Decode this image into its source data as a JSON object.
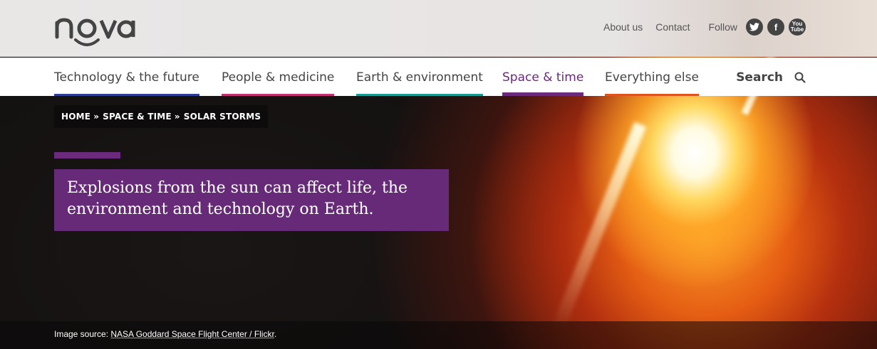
{
  "header": {
    "logo_text": "nova",
    "links": [
      "About us",
      "Contact"
    ],
    "follow_label": "Follow",
    "social": [
      {
        "icon": "twitter-icon",
        "glyph": "t"
      },
      {
        "icon": "facebook-icon",
        "glyph": "f"
      },
      {
        "icon": "youtube-icon",
        "glyph": "You Tube"
      }
    ]
  },
  "nav": {
    "items": [
      {
        "label": "Technology & the future",
        "color": "#2e3f95"
      },
      {
        "label": "People & medicine",
        "color": "#c2306f"
      },
      {
        "label": "Earth & environment",
        "color": "#1a9c95"
      },
      {
        "label": "Space & time",
        "color": "#6b2a7c",
        "active": true
      },
      {
        "label": "Everything else",
        "color": "#e0531c"
      }
    ],
    "search_label": "Search"
  },
  "breadcrumb": {
    "items": [
      "HOME",
      "SPACE & TIME",
      "SOLAR STORMS"
    ],
    "separator": "»"
  },
  "hero": {
    "title": "Explosions from the sun can affect life, the environment and technology on Earth.",
    "accent_color": "#6b2a7c"
  },
  "caption": {
    "prefix": "Image source: ",
    "source": "NASA Goddard Space Flight Center / Flickr",
    "suffix": "."
  }
}
